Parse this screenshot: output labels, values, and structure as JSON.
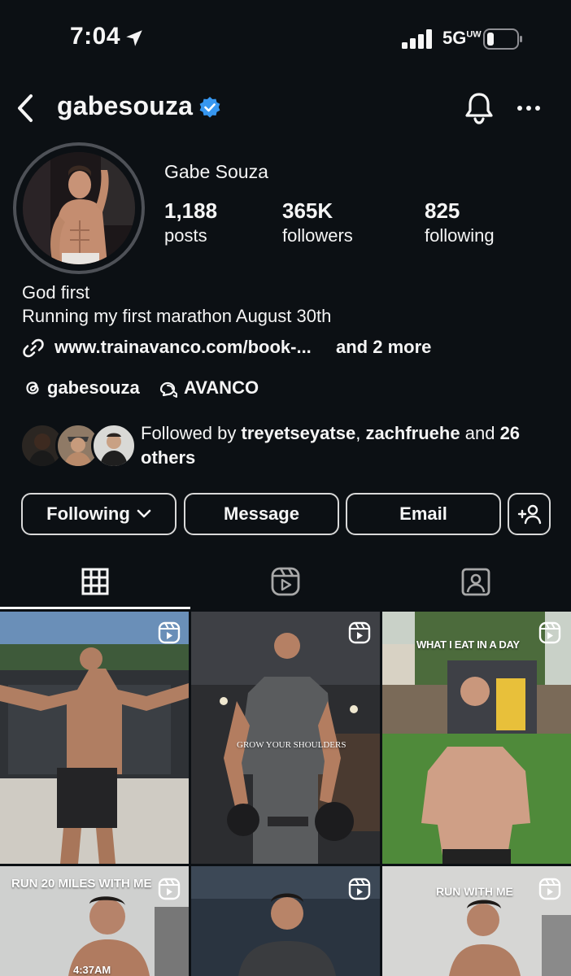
{
  "status_bar": {
    "time": "7:04",
    "network": "5G",
    "network_suffix": "UW"
  },
  "header": {
    "username": "gabesouza",
    "icons": [
      "back-arrow-icon",
      "verified-badge-icon",
      "bell-icon",
      "more-icon"
    ]
  },
  "profile": {
    "display_name": "Gabe Souza",
    "stats": [
      {
        "value": "1,188",
        "label": "posts"
      },
      {
        "value": "365K",
        "label": "followers"
      },
      {
        "value": "825",
        "label": "following"
      }
    ],
    "bio": [
      "God first",
      "Running my first marathon August 30th"
    ],
    "link": "www.trainavanco.com/book-...",
    "link_more": "and 2 more",
    "threads_handle": "gabesouza",
    "community": "AVANCO"
  },
  "followed_by": {
    "prefix": "Followed by",
    "name1": "treyetseyatse",
    "separator": ",",
    "name2": "zachfruehe",
    "conjunction": "and",
    "others": "26 others"
  },
  "actions": {
    "following": "Following",
    "message": "Message",
    "email": "Email"
  },
  "tabs": [
    "grid-icon",
    "reels-icon",
    "tagged-icon"
  ],
  "posts": [
    {
      "caption": "",
      "kind": "reel"
    },
    {
      "caption": "GROW YOUR SHOULDERS",
      "kind": "reel"
    },
    {
      "caption": "WHAT I EAT IN A DAY",
      "kind": "reel"
    },
    {
      "caption": "RUN 20 MILES WITH ME",
      "extra": "4:37AM",
      "kind": "reel"
    },
    {
      "caption": "",
      "kind": "reel"
    },
    {
      "caption": "RUN WITH ME",
      "kind": "reel"
    }
  ],
  "colors": {
    "background": "#0c1014",
    "text": "#f5f5f5",
    "verified": "#3797f0",
    "button_border": "#d9d9d9"
  }
}
